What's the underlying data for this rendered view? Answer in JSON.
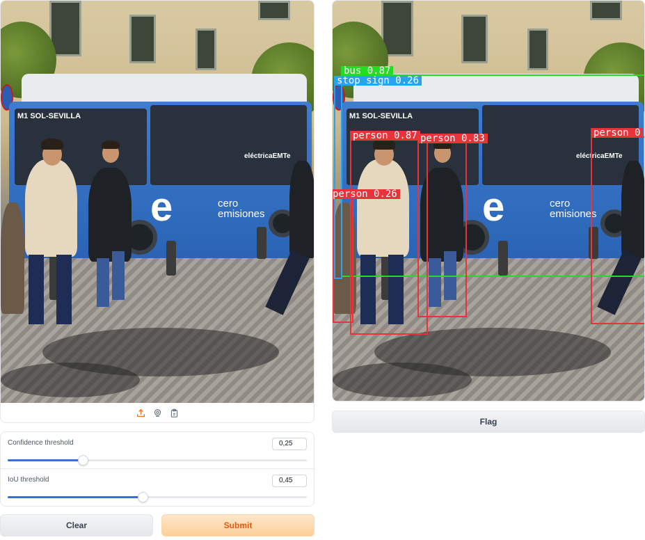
{
  "input_image": {
    "alt": "",
    "toolbar": [
      {
        "icon": "upload-icon",
        "color": "#f97316"
      },
      {
        "icon": "webcam-icon",
        "color": "#6b7280"
      },
      {
        "icon": "clipboard-icon",
        "color": "#6b7280"
      }
    ]
  },
  "controls": {
    "confidence": {
      "label": "Confidence threshold",
      "value": "0,25",
      "fraction": 0.25
    },
    "iou": {
      "label": "IoU threshold",
      "value": "0,45",
      "fraction": 0.45
    }
  },
  "buttons": {
    "clear_label": "Clear",
    "submit_label": "Submit",
    "flag_label": "Flag"
  },
  "output_image": {
    "detections": [
      {
        "label": "bus 0.87",
        "color": "#22dd22"
      },
      {
        "label": "stop sign 0.26",
        "color": "#27a3f0"
      },
      {
        "label": "person 0.87",
        "color": "#e8333a"
      },
      {
        "label": "person 0.83",
        "color": "#e8333a"
      },
      {
        "label": "person 0.26",
        "color": "#e8333a"
      },
      {
        "label": "person 0",
        "color": "#e8333a"
      }
    ]
  },
  "scene_text": {
    "bus_destination": "M1 SOL-SEVILLA",
    "bus_slogan_1": "cero",
    "bus_slogan_2": "emisiones",
    "bus_brand": "eléctricaEMTe"
  }
}
